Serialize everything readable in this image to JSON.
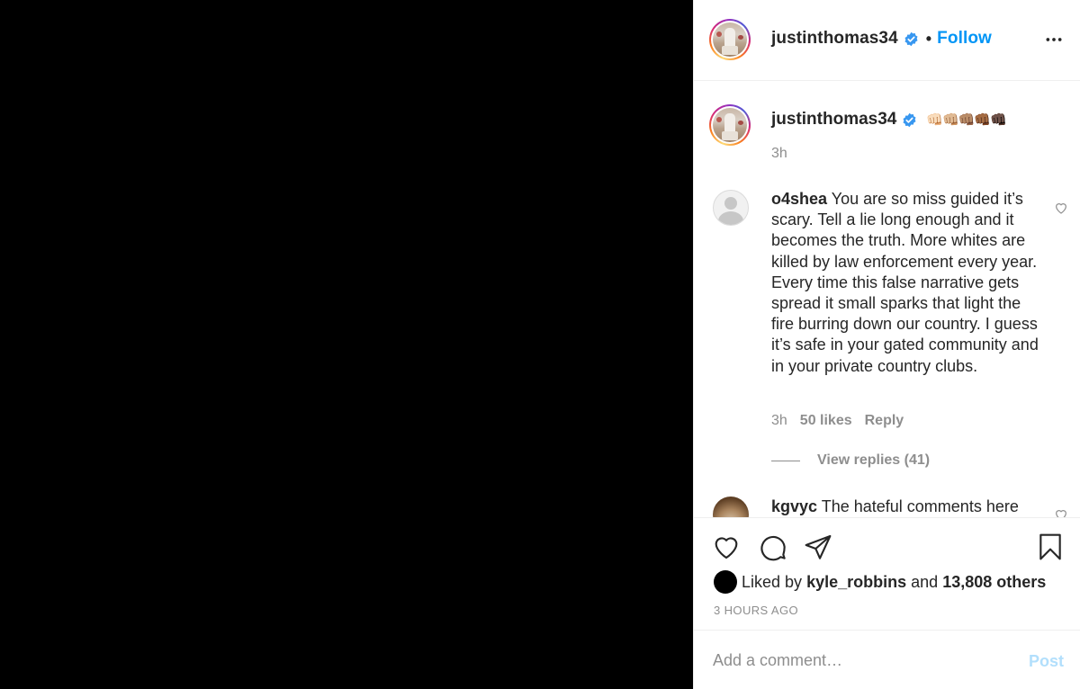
{
  "header": {
    "username": "justinthomas34",
    "dot": "•",
    "follow_label": "Follow",
    "more_icon": "more-horizontal-icon"
  },
  "caption": {
    "username": "justinthomas34",
    "emoji": "👊🏻👊🏼👊🏽👊🏾👊🏿",
    "time": "3h"
  },
  "comments": [
    {
      "username": "o4shea",
      "text": "You are so miss guided it’s scary. Tell a lie long enough and it becomes the truth. More whites are killed by law enforcement every year. Every time this false narrative gets spread it small sparks that light the fire burring down our country. I guess it’s safe in your gated community and in your private country clubs.",
      "time": "3h",
      "likes": "50 likes",
      "reply_label": "Reply",
      "view_replies": "View replies (41)"
    },
    {
      "username": "kgvyc",
      "text": "The hateful comments here"
    }
  ],
  "actions": {
    "liked_by_prefix": "Liked by",
    "liked_by_user": "kyle_robbins",
    "liked_by_and": "and",
    "liked_by_count": "13,808 others",
    "time_ago": "3 HOURS AGO"
  },
  "add_comment": {
    "placeholder": "Add a comment…",
    "post_label": "Post"
  },
  "colors": {
    "accent": "#0095f6",
    "post_disabled": "#b2dffc",
    "muted": "#8e8e8e",
    "text": "#262626"
  }
}
